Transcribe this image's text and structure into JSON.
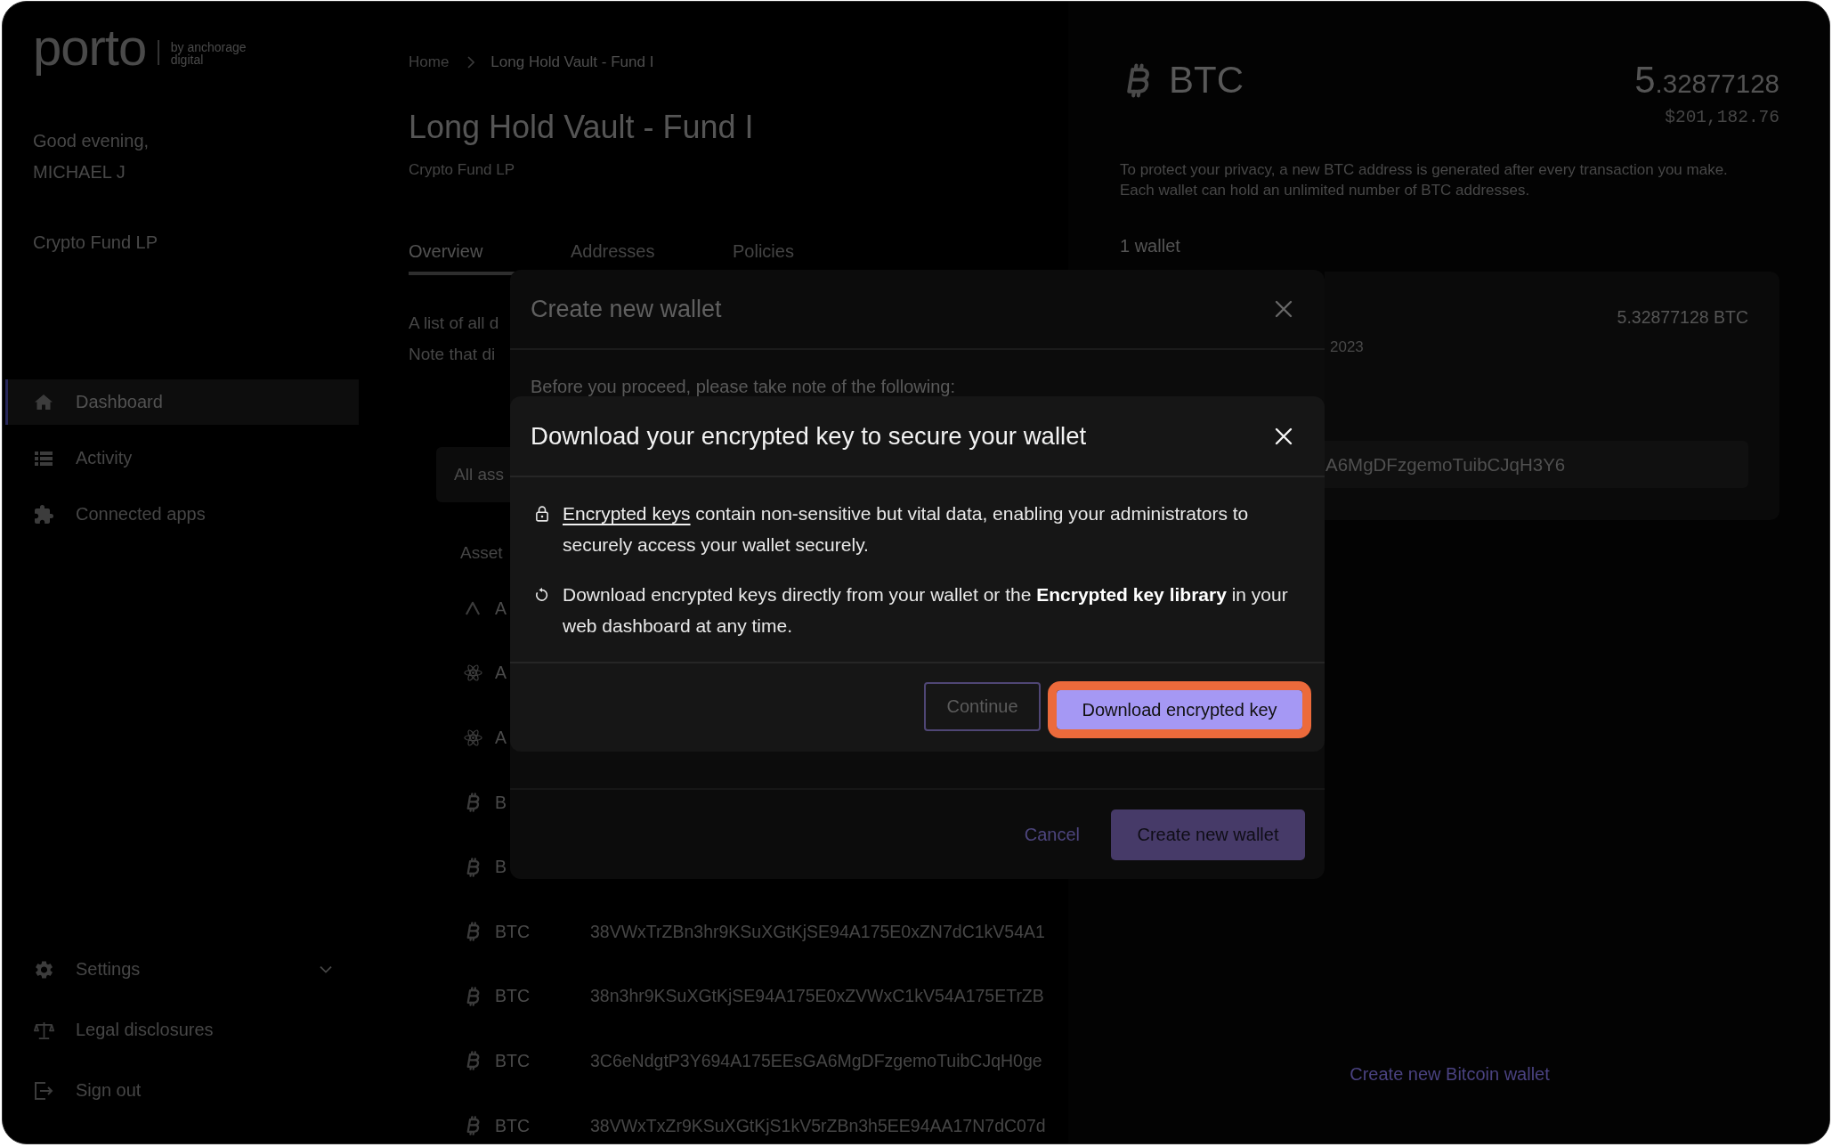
{
  "sidebar": {
    "logo": {
      "wordmark": "porto",
      "tagline": "by anchorage digital"
    },
    "greeting": "Good evening,",
    "user_name": "MICHAEL J",
    "organization": "Crypto Fund LP",
    "nav": [
      {
        "label": "Dashboard",
        "selected": true
      },
      {
        "label": "Activity",
        "selected": false
      },
      {
        "label": "Connected apps",
        "selected": false
      }
    ],
    "footer_nav": [
      {
        "label": "Settings",
        "expandable": true
      },
      {
        "label": "Legal disclosures",
        "expandable": false
      },
      {
        "label": "Sign out",
        "expandable": false
      }
    ]
  },
  "main": {
    "breadcrumb": [
      {
        "label": "Home",
        "current": false
      },
      {
        "label": "Long Hold Vault - Fund I",
        "current": true
      }
    ],
    "title": "Long Hold Vault - Fund I",
    "subtitle": "Crypto Fund LP",
    "tabs": [
      {
        "label": "Overview",
        "selected": true
      },
      {
        "label": "Addresses",
        "selected": false
      },
      {
        "label": "Policies",
        "selected": false
      }
    ],
    "description_lines": [
      "A list of all d",
      "Note that di"
    ],
    "filter": {
      "value": "All ass"
    },
    "table": {
      "columns": [
        "Asset"
      ],
      "rows": [
        {
          "asset": "A"
        },
        {
          "asset": "A"
        },
        {
          "asset": "A"
        },
        {
          "asset": "B"
        },
        {
          "asset": "B"
        },
        {
          "asset": "BTC",
          "address": "38VWxTrZBn3hr9KSuXGtKjSE94A175E0xZN7dC1kV54A1"
        },
        {
          "asset": "BTC",
          "address": "38n3hr9KSuXGtKjSE94A175E0xZVWxC1kV54A175ETrZB"
        },
        {
          "asset": "BTC",
          "address": "3C6eNdgtP3Y694A175EEsGA6MgDFzgemoTuibCJqH0ge"
        },
        {
          "asset": "BTC",
          "address": "38VWxTxZr9KSuXGtKjS1kV5rZBn3h5EE94AA17N7dC07d"
        }
      ]
    }
  },
  "asset_panel": {
    "symbol": "BTC",
    "balance_whole": "5",
    "balance_fraction": ".32877128",
    "balance_fiat": "$201,182.76",
    "privacy_note": "To protect your privacy, a new BTC address is generated after every transaction you make. Each wallet can hold an unlimited number of BTC addresses.",
    "wallet_count": "1 wallet",
    "wallets": [
      {
        "balance": "5.32877128 BTC",
        "date": "2023",
        "address": "A6MgDFzgemoTuibCJqH3Y6"
      }
    ],
    "create_link": "Create new Bitcoin wallet"
  },
  "create_wallet_dialog": {
    "title": "Create new wallet",
    "intro": "Before you proceed, please take note of the following:",
    "buttons": [
      {
        "label": "Cancel",
        "kind": "link"
      },
      {
        "label": "Create new wallet",
        "kind": "primary"
      }
    ]
  },
  "encrypted_key_dialog": {
    "title": "Download your encrypted key to secure your wallet",
    "notes": [
      {
        "link": "Encrypted keys",
        "text": "contain non-sensitive but vital data, enabling your administrators to securely access your wallet securely."
      },
      {
        "text": "Download encrypted keys directly from your wallet or the **Encrypted key library** in your web dashboard at any time."
      }
    ],
    "buttons": [
      {
        "label": "Continue",
        "kind": "secondary",
        "focused": false
      },
      {
        "label": "Download encrypted key",
        "kind": "primary",
        "focused": true
      }
    ]
  }
}
